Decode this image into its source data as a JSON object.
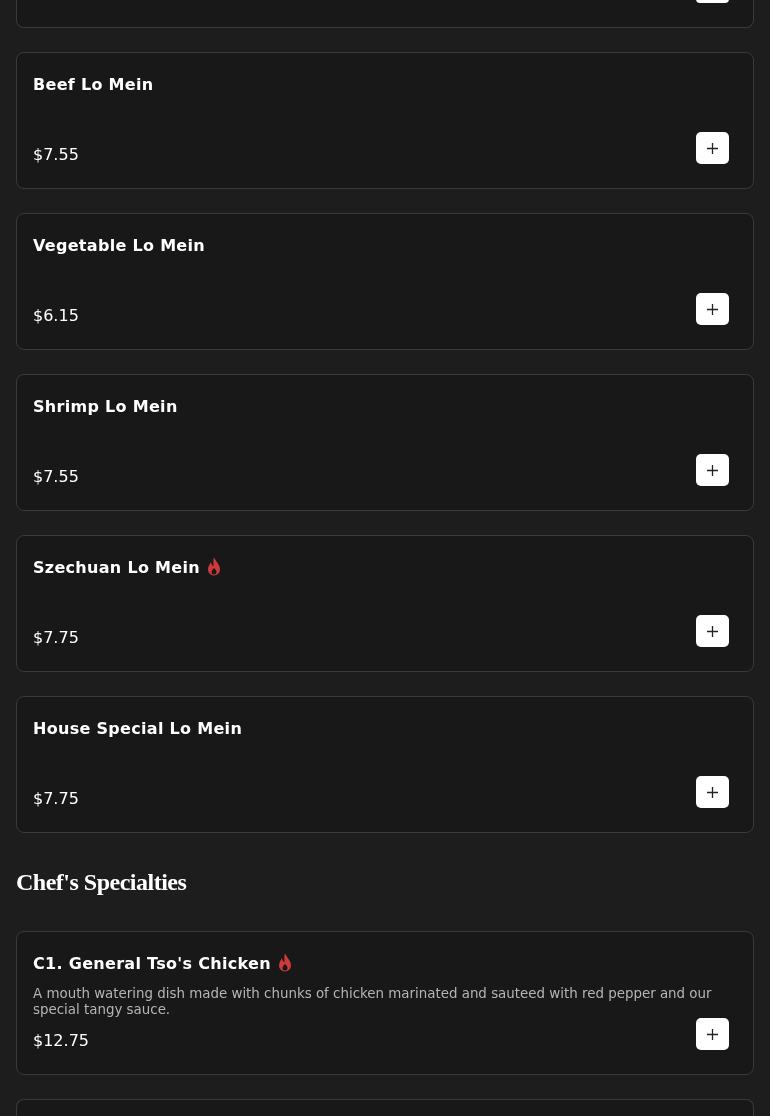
{
  "sections": [
    {
      "kind": "items",
      "items": [
        {
          "name": "Beef Lo Mein",
          "spicy": false,
          "price": "$7.55"
        },
        {
          "name": "Vegetable Lo Mein",
          "spicy": false,
          "price": "$6.15"
        },
        {
          "name": "Shrimp Lo Mein",
          "spicy": false,
          "price": "$7.55"
        },
        {
          "name": "Szechuan Lo Mein",
          "spicy": true,
          "price": "$7.75"
        },
        {
          "name": "House Special Lo Mein",
          "spicy": false,
          "price": "$7.75"
        }
      ]
    },
    {
      "kind": "category",
      "title": "Chef's Specialties",
      "items": [
        {
          "name": "C1. General Tso's Chicken",
          "spicy": true,
          "description": "A mouth watering dish made with chunks of chicken marinated and sauteed with red pepper and our special tangy sauce.",
          "price": "$12.75"
        }
      ]
    }
  ]
}
